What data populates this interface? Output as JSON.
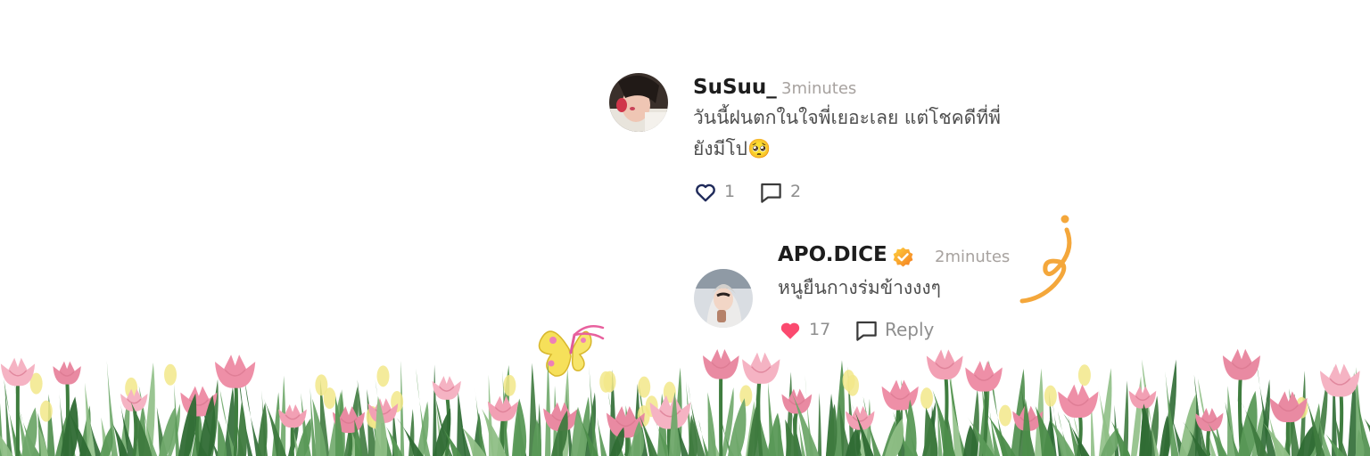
{
  "comment": {
    "username": "SuSuu_",
    "time": "3minutes",
    "text_line1": "วันนี้ฝนตกในใจพี่เยอะเลย แต่โชคดีที่พี่",
    "text_line2": "ยังมีโป",
    "emoji": "🥺",
    "like_count": "1",
    "reply_count": "2",
    "liked": false
  },
  "reply": {
    "username": "APO.DICE",
    "verified": true,
    "time": "2minutes",
    "text": "หนูยืนกางร่มข้างงงๆ",
    "like_count": "17",
    "reply_label": "Reply",
    "liked": true
  },
  "colors": {
    "like_active": "#fb4a6f",
    "like_outline": "#1f2a5a",
    "verified": "#f6a21c",
    "doodle": "#f4a73b"
  },
  "icons": [
    "heart-icon",
    "comment-icon",
    "verified-badge-icon",
    "butterfly-doodle",
    "ribbon-doodle",
    "tulip-field"
  ]
}
